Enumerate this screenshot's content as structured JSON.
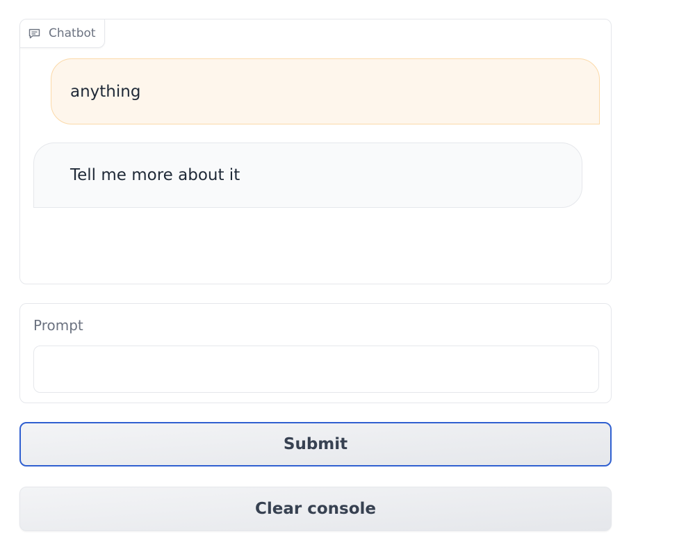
{
  "chatbot": {
    "label": "Chatbot",
    "icon": "chat-icon",
    "messages": [
      {
        "role": "user",
        "text": "anything"
      },
      {
        "role": "bot",
        "text": "Tell me more about it"
      }
    ]
  },
  "prompt": {
    "label": "Prompt",
    "value": "",
    "placeholder": ""
  },
  "buttons": {
    "submit_label": "Submit",
    "clear_label": "Clear console"
  },
  "colors": {
    "user_bubble_bg": "#fef6ec",
    "user_bubble_border": "#fbd9a8",
    "bot_bubble_bg": "#f9fafb",
    "focus_border": "#2f5fd0"
  }
}
